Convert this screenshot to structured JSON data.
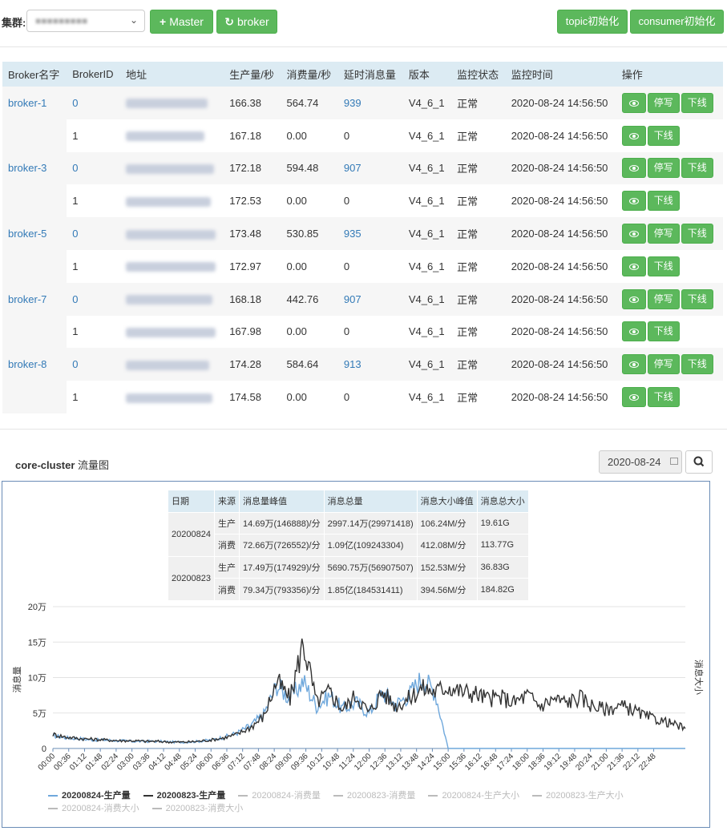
{
  "topbar": {
    "cluster_label": "集群:",
    "master_btn": "Master",
    "broker_btn": "broker",
    "topic_init_btn": "topic初始化",
    "consumer_init_btn": "consumer初始化"
  },
  "broker_table": {
    "headers": [
      "Broker名字",
      "BrokerID",
      "地址",
      "生产量/秒",
      "消费量/秒",
      "延时消息量",
      "版本",
      "监控状态",
      "监控时间",
      "操作"
    ],
    "rows": [
      {
        "name": "broker-1",
        "id": "0",
        "produce": "166.38",
        "consume": "564.74",
        "delay": "939",
        "version": "V4_6_1",
        "status": "正常",
        "time": "2020-08-24 14:56:50",
        "master": true
      },
      {
        "name": "",
        "id": "1",
        "produce": "167.18",
        "consume": "0.00",
        "delay": "0",
        "version": "V4_6_1",
        "status": "正常",
        "time": "2020-08-24 14:56:50",
        "master": false
      },
      {
        "name": "broker-3",
        "id": "0",
        "produce": "172.18",
        "consume": "594.48",
        "delay": "907",
        "version": "V4_6_1",
        "status": "正常",
        "time": "2020-08-24 14:56:50",
        "master": true
      },
      {
        "name": "",
        "id": "1",
        "produce": "172.53",
        "consume": "0.00",
        "delay": "0",
        "version": "V4_6_1",
        "status": "正常",
        "time": "2020-08-24 14:56:50",
        "master": false
      },
      {
        "name": "broker-5",
        "id": "0",
        "produce": "173.48",
        "consume": "530.85",
        "delay": "935",
        "version": "V4_6_1",
        "status": "正常",
        "time": "2020-08-24 14:56:50",
        "master": true
      },
      {
        "name": "",
        "id": "1",
        "produce": "172.97",
        "consume": "0.00",
        "delay": "0",
        "version": "V4_6_1",
        "status": "正常",
        "time": "2020-08-24 14:56:50",
        "master": false
      },
      {
        "name": "broker-7",
        "id": "0",
        "produce": "168.18",
        "consume": "442.76",
        "delay": "907",
        "version": "V4_6_1",
        "status": "正常",
        "time": "2020-08-24 14:56:50",
        "master": true
      },
      {
        "name": "",
        "id": "1",
        "produce": "167.98",
        "consume": "0.00",
        "delay": "0",
        "version": "V4_6_1",
        "status": "正常",
        "time": "2020-08-24 14:56:50",
        "master": false
      },
      {
        "name": "broker-8",
        "id": "0",
        "produce": "174.28",
        "consume": "584.64",
        "delay": "913",
        "version": "V4_6_1",
        "status": "正常",
        "time": "2020-08-24 14:56:50",
        "master": true
      },
      {
        "name": "",
        "id": "1",
        "produce": "174.58",
        "consume": "0.00",
        "delay": "0",
        "version": "V4_6_1",
        "status": "正常",
        "time": "2020-08-24 14:56:50",
        "master": false
      }
    ],
    "pause_write_label": "停写",
    "offline_label": "下线"
  },
  "traffic": {
    "title_bold": "core-cluster",
    "title_rest": " 流量图",
    "date_value": "2020-08-24",
    "summary_headers": [
      "日期",
      "来源",
      "消息量峰值",
      "消息总量",
      "消息大小峰值",
      "消息总大小"
    ],
    "summary_rows": [
      {
        "date": "20200824",
        "source": "生产",
        "peak": "14.69万(146888)/分",
        "total": "2997.14万(29971418)",
        "size_peak": "106.24M/分",
        "size_total": "19.61G"
      },
      {
        "date": "20200824",
        "source": "消费",
        "peak": "72.66万(726552)/分",
        "total": "1.09亿(109243304)",
        "size_peak": "412.08M/分",
        "size_total": "113.77G"
      },
      {
        "date": "20200823",
        "source": "生产",
        "peak": "17.49万(174929)/分",
        "total": "5690.75万(56907507)",
        "size_peak": "152.53M/分",
        "size_total": "36.83G"
      },
      {
        "date": "20200823",
        "source": "消费",
        "peak": "79.34万(793356)/分",
        "total": "1.85亿(184531411)",
        "size_peak": "394.56M/分",
        "size_total": "184.82G"
      }
    ]
  },
  "chart_data": {
    "type": "line",
    "title": "",
    "ylabel": "消息量",
    "y2label": "消息大小",
    "ylim": [
      0,
      200000
    ],
    "y_ticks": [
      "0",
      "5万",
      "10万",
      "15万",
      "20万"
    ],
    "x_ticks": [
      "00:00",
      "00:36",
      "01:12",
      "01:48",
      "02:24",
      "03:00",
      "03:36",
      "04:12",
      "04:48",
      "05:24",
      "06:00",
      "06:36",
      "07:12",
      "07:48",
      "08:24",
      "09:00",
      "09:36",
      "10:12",
      "10:48",
      "11:24",
      "12:00",
      "12:36",
      "13:12",
      "13:48",
      "14:24",
      "15:00",
      "15:36",
      "16:12",
      "16:48",
      "17:24",
      "18:00",
      "18:36",
      "19:12",
      "19:48",
      "20:24",
      "21:00",
      "21:36",
      "22:12",
      "22:48"
    ],
    "x_hours": [
      0,
      0.5,
      1,
      1.5,
      2,
      2.5,
      3,
      3.5,
      4,
      4.5,
      5,
      5.5,
      6,
      6.5,
      7,
      7.5,
      8,
      8.5,
      9,
      9.5,
      10,
      10.5,
      11,
      11.5,
      12,
      12.5,
      13,
      13.5,
      14,
      14.5,
      15,
      15.5,
      16,
      16.5,
      17,
      17.5,
      18,
      18.5,
      19,
      19.5,
      20,
      20.5,
      21,
      21.5,
      22,
      22.5,
      23,
      23.5,
      24
    ],
    "series": [
      {
        "name": "20200824-生产量",
        "color": "#6fa8dc",
        "active": true,
        "values": [
          18000,
          15000,
          14000,
          12000,
          12000,
          11000,
          10000,
          10000,
          10000,
          9000,
          9000,
          10000,
          12000,
          16000,
          22000,
          32000,
          48000,
          90000,
          70000,
          95000,
          60000,
          75000,
          55000,
          65000,
          50000,
          80000,
          62000,
          75000,
          100000,
          80000,
          0,
          0,
          0,
          0,
          0,
          0,
          0,
          0,
          0,
          0,
          0,
          0,
          0,
          0,
          0,
          0,
          0,
          0,
          0
        ]
      },
      {
        "name": "20200823-生产量",
        "color": "#333333",
        "active": true,
        "values": [
          20000,
          16000,
          14000,
          13000,
          12000,
          11000,
          11000,
          10000,
          10000,
          9000,
          9000,
          10000,
          12000,
          15000,
          20000,
          30000,
          45000,
          95000,
          70000,
          150000,
          65000,
          80000,
          55000,
          75000,
          50000,
          80000,
          60000,
          70000,
          85000,
          80000,
          88000,
          80000,
          78000,
          70000,
          72000,
          65000,
          75000,
          60000,
          70000,
          65000,
          72000,
          60000,
          55000,
          60000,
          55000,
          45000,
          40000,
          35000,
          28000
        ]
      },
      {
        "name": "20200824-消费量",
        "color": "#bbbbbb",
        "active": false,
        "values": []
      },
      {
        "name": "20200823-消费量",
        "color": "#bbbbbb",
        "active": false,
        "values": []
      },
      {
        "name": "20200824-生产大小",
        "color": "#bbbbbb",
        "active": false,
        "values": []
      },
      {
        "name": "20200823-生产大小",
        "color": "#bbbbbb",
        "active": false,
        "values": []
      },
      {
        "name": "20200824-消费大小",
        "color": "#bbbbbb",
        "active": false,
        "values": []
      },
      {
        "name": "20200823-消费大小",
        "color": "#bbbbbb",
        "active": false,
        "values": []
      }
    ]
  }
}
